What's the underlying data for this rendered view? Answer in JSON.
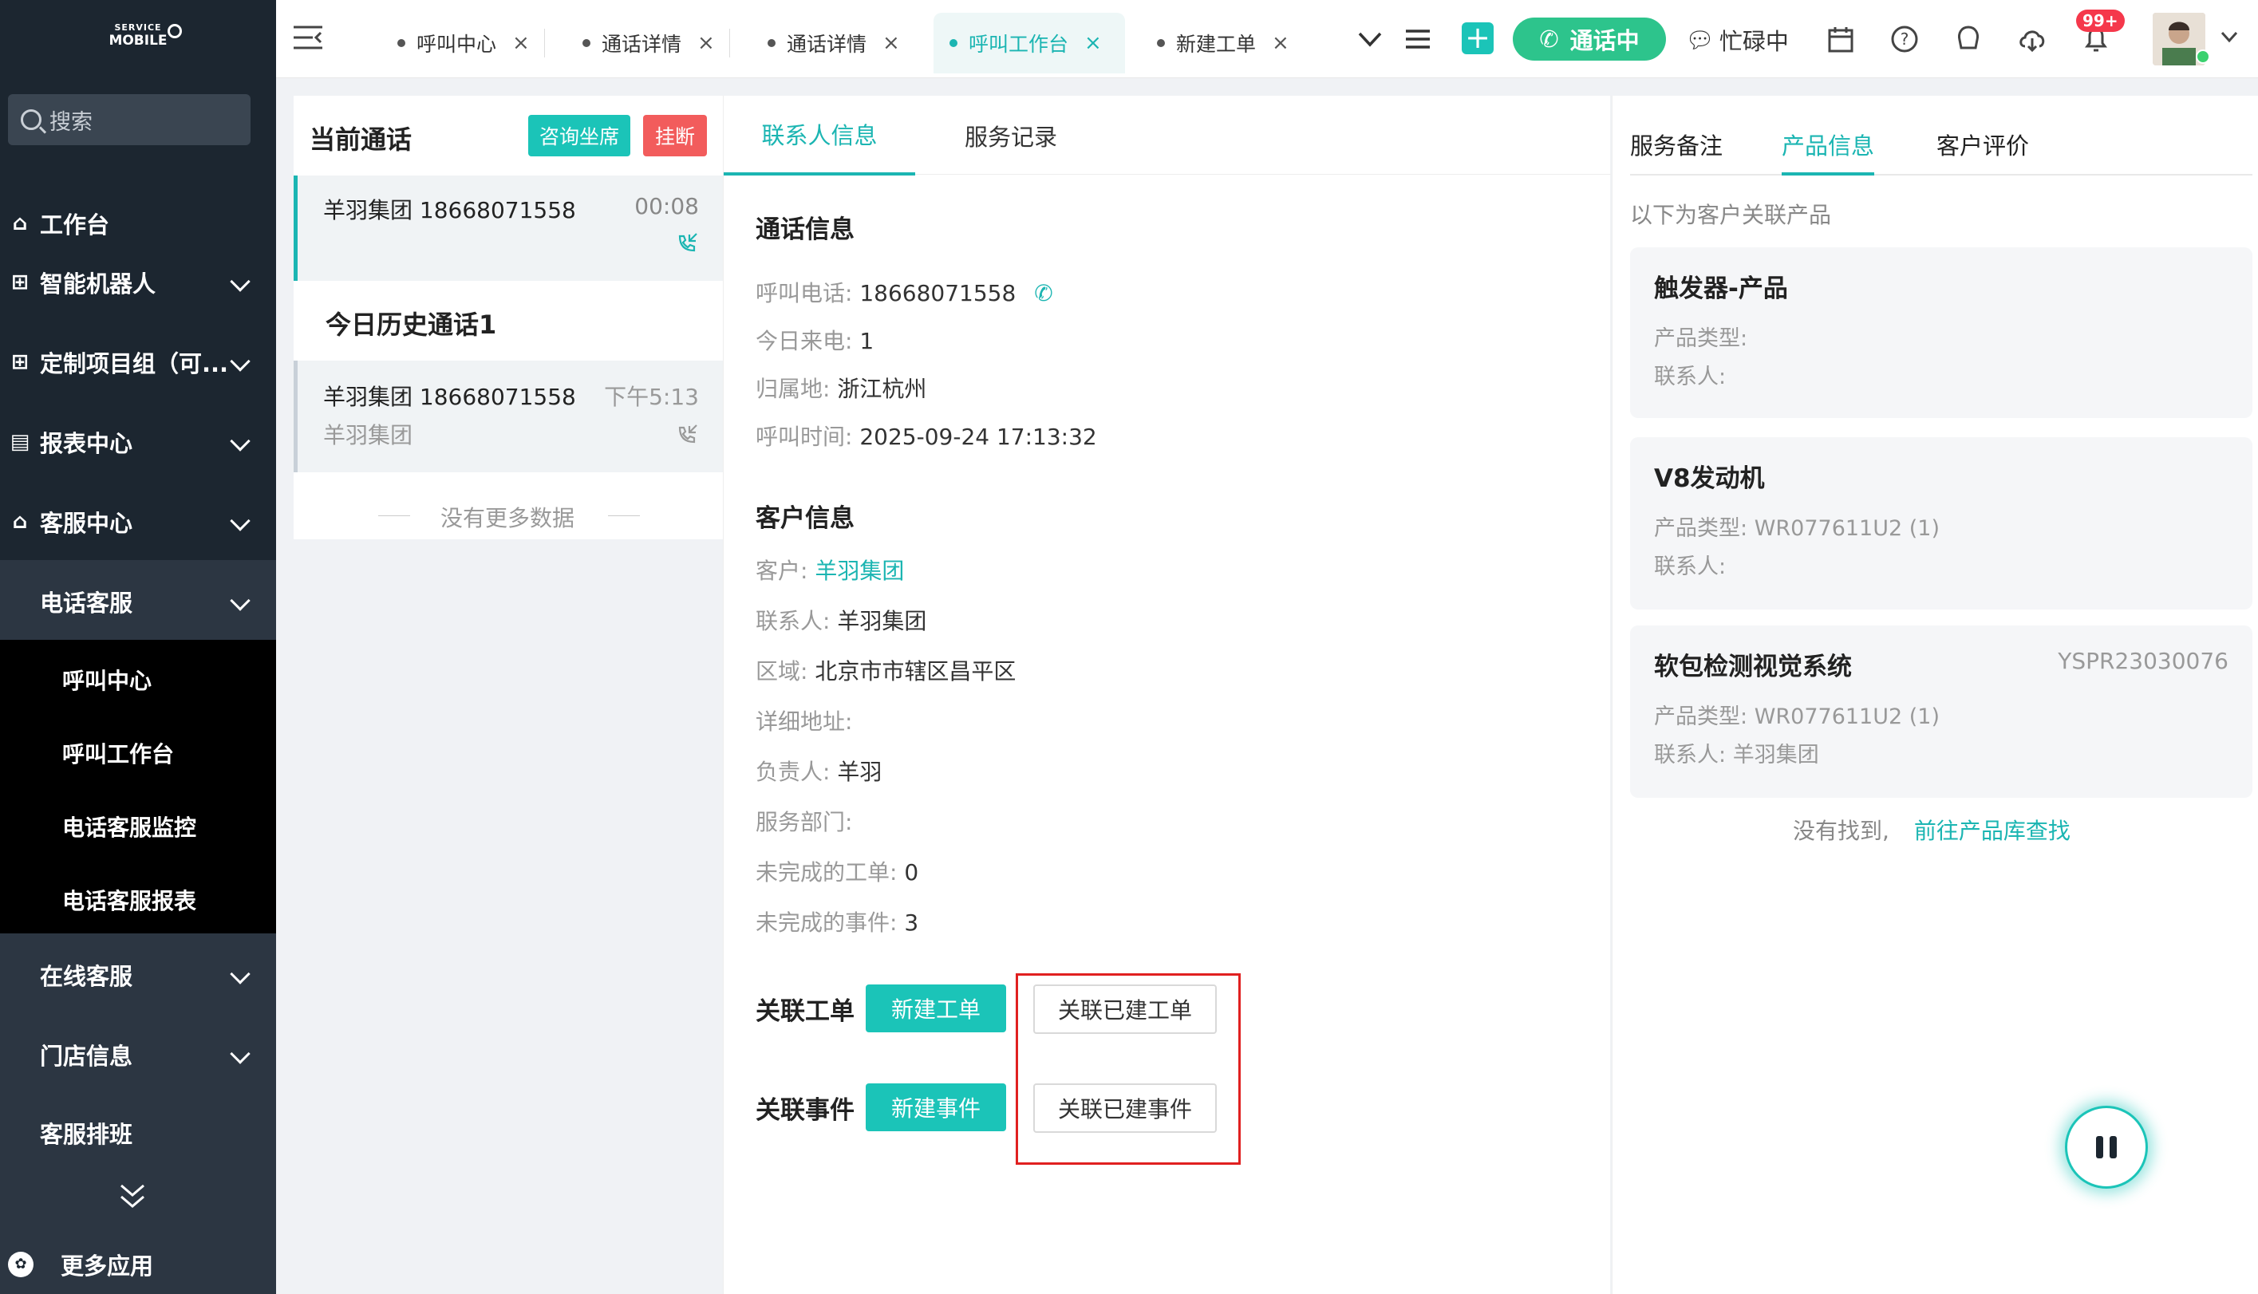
{
  "app": {
    "logo_top": "SERVICE",
    "logo_bottom": "MOBILE"
  },
  "sidebar": {
    "search_placeholder": "搜索",
    "items": [
      {
        "label": "工作台",
        "icon": "home-icon"
      },
      {
        "label": "智能机器人",
        "icon": "org-icon"
      },
      {
        "label": "定制项目组（可...",
        "icon": "org-icon"
      },
      {
        "label": "报表中心",
        "icon": "report-icon"
      },
      {
        "label": "客服中心",
        "icon": "service-icon"
      }
    ],
    "phone_service": {
      "label": "电话客服",
      "children": [
        "呼叫中心",
        "呼叫工作台",
        "电话客服监控",
        "电话客服报表"
      ]
    },
    "after": [
      "在线客服",
      "门店信息",
      "客服排班"
    ],
    "more_apps": "更多应用"
  },
  "topbar": {
    "tabs": [
      {
        "label": "呼叫中心",
        "active": false
      },
      {
        "label": "通话详情",
        "active": false
      },
      {
        "label": "通话详情",
        "active": false
      },
      {
        "label": "呼叫工作台",
        "active": true
      },
      {
        "label": "新建工单",
        "active": false
      }
    ],
    "calling_label": "通话中",
    "busy_label": "忙碌中",
    "badge": "99+"
  },
  "current_call": {
    "title": "当前通话",
    "consult_btn": "咨询坐席",
    "hangup_btn": "挂断",
    "active_call": {
      "name": "羊羽集团 18668071558",
      "duration": "00:08"
    },
    "history_title": "今日历史通话1",
    "history": [
      {
        "name": "羊羽集团 18668071558",
        "time": "下午5:13",
        "sub": "羊羽集团"
      }
    ],
    "no_more": "没有更多数据"
  },
  "contact": {
    "tabs": [
      "联系人信息",
      "服务记录"
    ],
    "call_info_title": "通话信息",
    "call_fields": [
      {
        "label": "呼叫电话:",
        "value": "18668071558"
      },
      {
        "label": "今日来电:",
        "value": "1"
      },
      {
        "label": "归属地:",
        "value": "浙江杭州"
      },
      {
        "label": "呼叫时间:",
        "value": "2025-09-24 17:13:32"
      }
    ],
    "customer_title": "客户信息",
    "customer_fields": [
      {
        "label": "客户:",
        "value": "羊羽集团"
      },
      {
        "label": "联系人:",
        "value": "羊羽集团"
      },
      {
        "label": "区域:",
        "value": "北京市市辖区昌平区"
      },
      {
        "label": "详细地址:",
        "value": ""
      },
      {
        "label": "负责人:",
        "value": "羊羽"
      },
      {
        "label": "服务部门:",
        "value": ""
      },
      {
        "label": "未完成的工单:",
        "value": "0"
      },
      {
        "label": "未完成的事件:",
        "value": "3"
      }
    ],
    "link_order_title": "关联工单",
    "new_order_btn": "新建工单",
    "link_order_btn": "关联已建工单",
    "link_event_title": "关联事件",
    "new_event_btn": "新建事件",
    "link_event_btn": "关联已建事件"
  },
  "products": {
    "tabs": [
      "服务备注",
      "产品信息",
      "客户评价"
    ],
    "hint": "以下为客户关联产品",
    "type_label": "产品类型:",
    "contact_label": "联系人:",
    "items": [
      {
        "name": "触发器-产品",
        "code": "",
        "type": "",
        "contact": ""
      },
      {
        "name": "V8发动机",
        "code": "",
        "type": "WR077611U2  (1)",
        "contact": ""
      },
      {
        "name": "软包检测视觉系统",
        "code": "YSPR23030076",
        "type": "WR077611U2  (1)",
        "contact": "羊羽集团"
      }
    ],
    "not_found": "没有找到,",
    "goto_link": "前往产品库查找"
  },
  "colors": {
    "accent": "#1bb5b2",
    "sidebar": "#1c2630",
    "calling": "#2dc48c",
    "danger": "#f25c5c",
    "highlight": "#e02020"
  }
}
